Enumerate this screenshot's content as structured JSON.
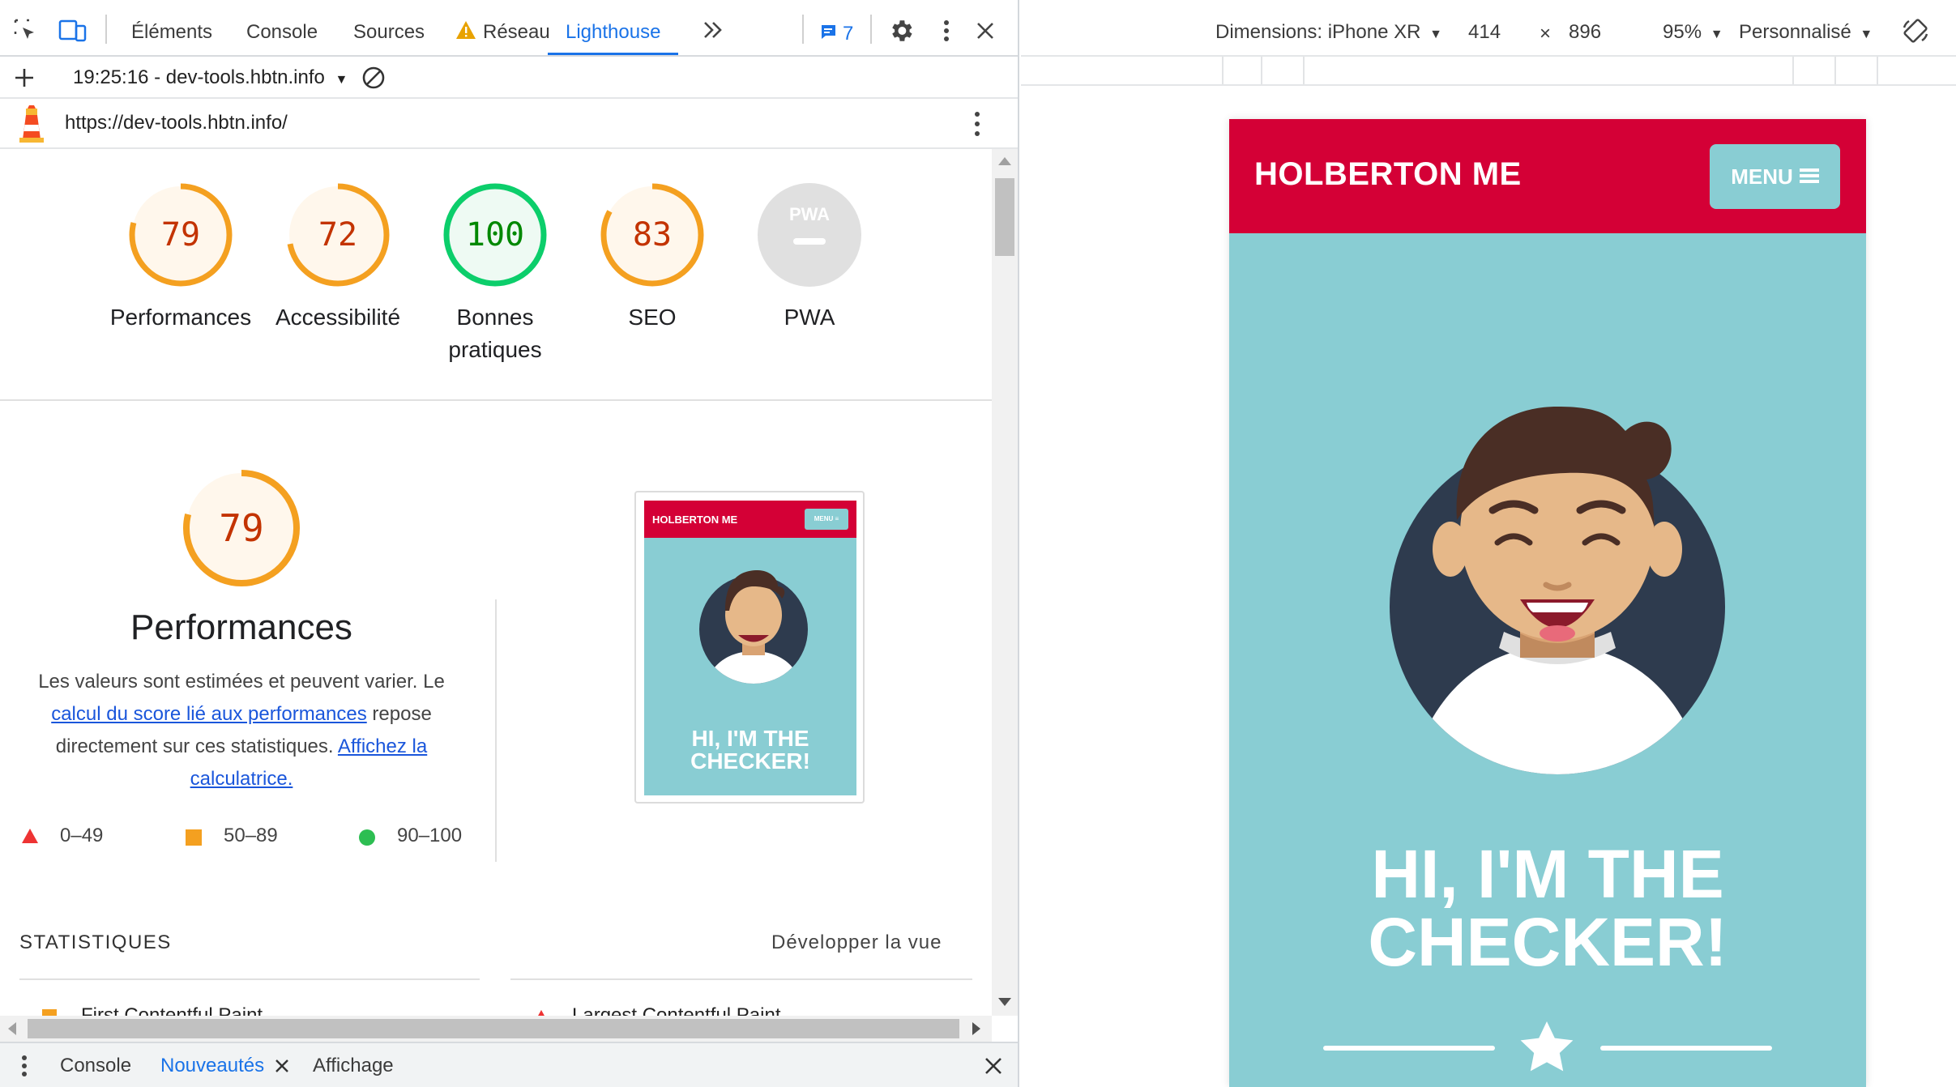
{
  "devtools": {
    "tabs": [
      "Éléments",
      "Console",
      "Sources",
      "Réseau",
      "Lighthouse"
    ],
    "active_tab": "Lighthouse",
    "more_tabs_icon": "chevron-double-right-icon",
    "issues_count": "7",
    "toolbar": {
      "report_label": "19:25:16 - dev-tools.hbtn.info"
    },
    "url": "https://dev-tools.hbtn.info/"
  },
  "scores": [
    {
      "value": "79",
      "label": "Performances",
      "percent": 79,
      "status": "average"
    },
    {
      "value": "72",
      "label": "Accessibilité",
      "percent": 72,
      "status": "average"
    },
    {
      "value": "100",
      "label": "Bonnes\npratiques",
      "percent": 100,
      "status": "pass"
    },
    {
      "value": "83",
      "label": "SEO",
      "percent": 83,
      "status": "average"
    },
    {
      "value": "PWA",
      "label": "PWA",
      "percent": 0,
      "status": "na"
    }
  ],
  "perf": {
    "score": "79",
    "percent": 79,
    "title": "Performances",
    "desc_1": "Les valeurs sont estimées et peuvent varier. Le",
    "link_1": "calcul du score lié aux performances",
    "desc_2": "repose",
    "desc_3": "directement sur ces statistiques.",
    "link_2": "Affichez la",
    "link_2b": "calculatrice.",
    "legend": [
      "0–49",
      "50–89",
      "90–100"
    ],
    "stats_label": "STATISTIQUES",
    "expand_label": "Développer la vue",
    "metric_1": "First Contentful Paint",
    "metric_2": "Largest Contentful Paint"
  },
  "thumbnail": {
    "brand": "HOLBERTON ME",
    "menu": "MENU ≡",
    "title_1": "HI, I'M THE",
    "title_2": "CHECKER!"
  },
  "drawer": {
    "tabs": [
      "Console",
      "Nouveautés",
      "Affichage"
    ],
    "active": "Nouveautés"
  },
  "device_toolbar": {
    "dimensions": "Dimensions: iPhone XR",
    "width": "414",
    "times": "×",
    "height": "896",
    "zoom": "95%",
    "throttle": "Personnalisé"
  },
  "phone": {
    "brand": "HOLBERTON ME",
    "menu_label": "MENU",
    "title_line1": "HI, I'M THE",
    "title_line2": "CHECKER!"
  },
  "colors": {
    "accent": "#1a73e8",
    "average": "#f4a020",
    "pass": "#0cce6b",
    "fail": "#ff3333",
    "brand_red": "#d40036",
    "teal": "#89cdd3"
  }
}
